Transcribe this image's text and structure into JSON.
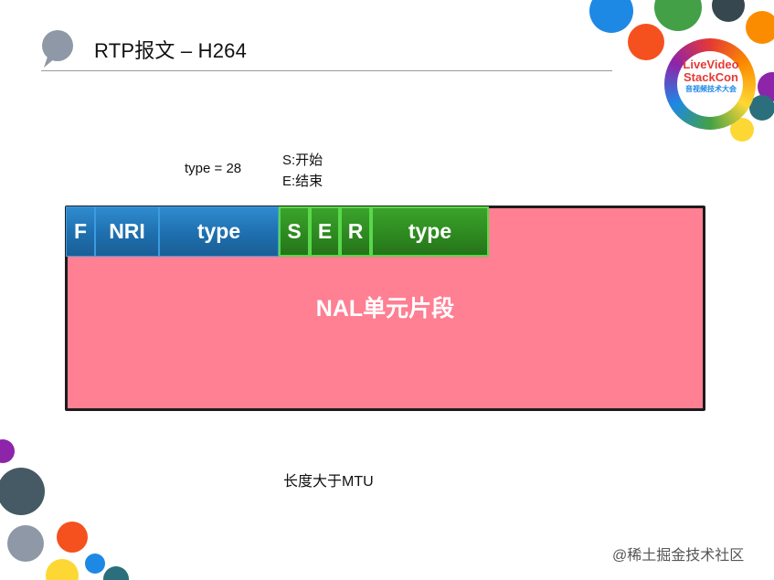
{
  "slide": {
    "title": "RTP报文 – H264"
  },
  "annotations": {
    "type_value": "type = 28",
    "s_meaning": "S:开始",
    "e_meaning": "E:结束"
  },
  "fu_indicator": [
    {
      "key": "f",
      "label": "F"
    },
    {
      "key": "nri",
      "label": "NRI"
    },
    {
      "key": "type",
      "label": "type"
    }
  ],
  "fu_header": [
    {
      "key": "s",
      "label": "S"
    },
    {
      "key": "e",
      "label": "E"
    },
    {
      "key": "r",
      "label": "R"
    },
    {
      "key": "type",
      "label": "type"
    }
  ],
  "payload": {
    "label": "NAL单元片段"
  },
  "footer": {
    "label": "长度大于MTU"
  },
  "logo": {
    "line1": "LiveVideo",
    "line2": "StackCon",
    "line3": "音视频技术大会"
  },
  "watermark": {
    "text": "@稀土掘金技术社区"
  },
  "colors": {
    "payload": "#ff7f93",
    "fu_indicator": "#1e6fae",
    "fu_header": "#2e8a20"
  }
}
